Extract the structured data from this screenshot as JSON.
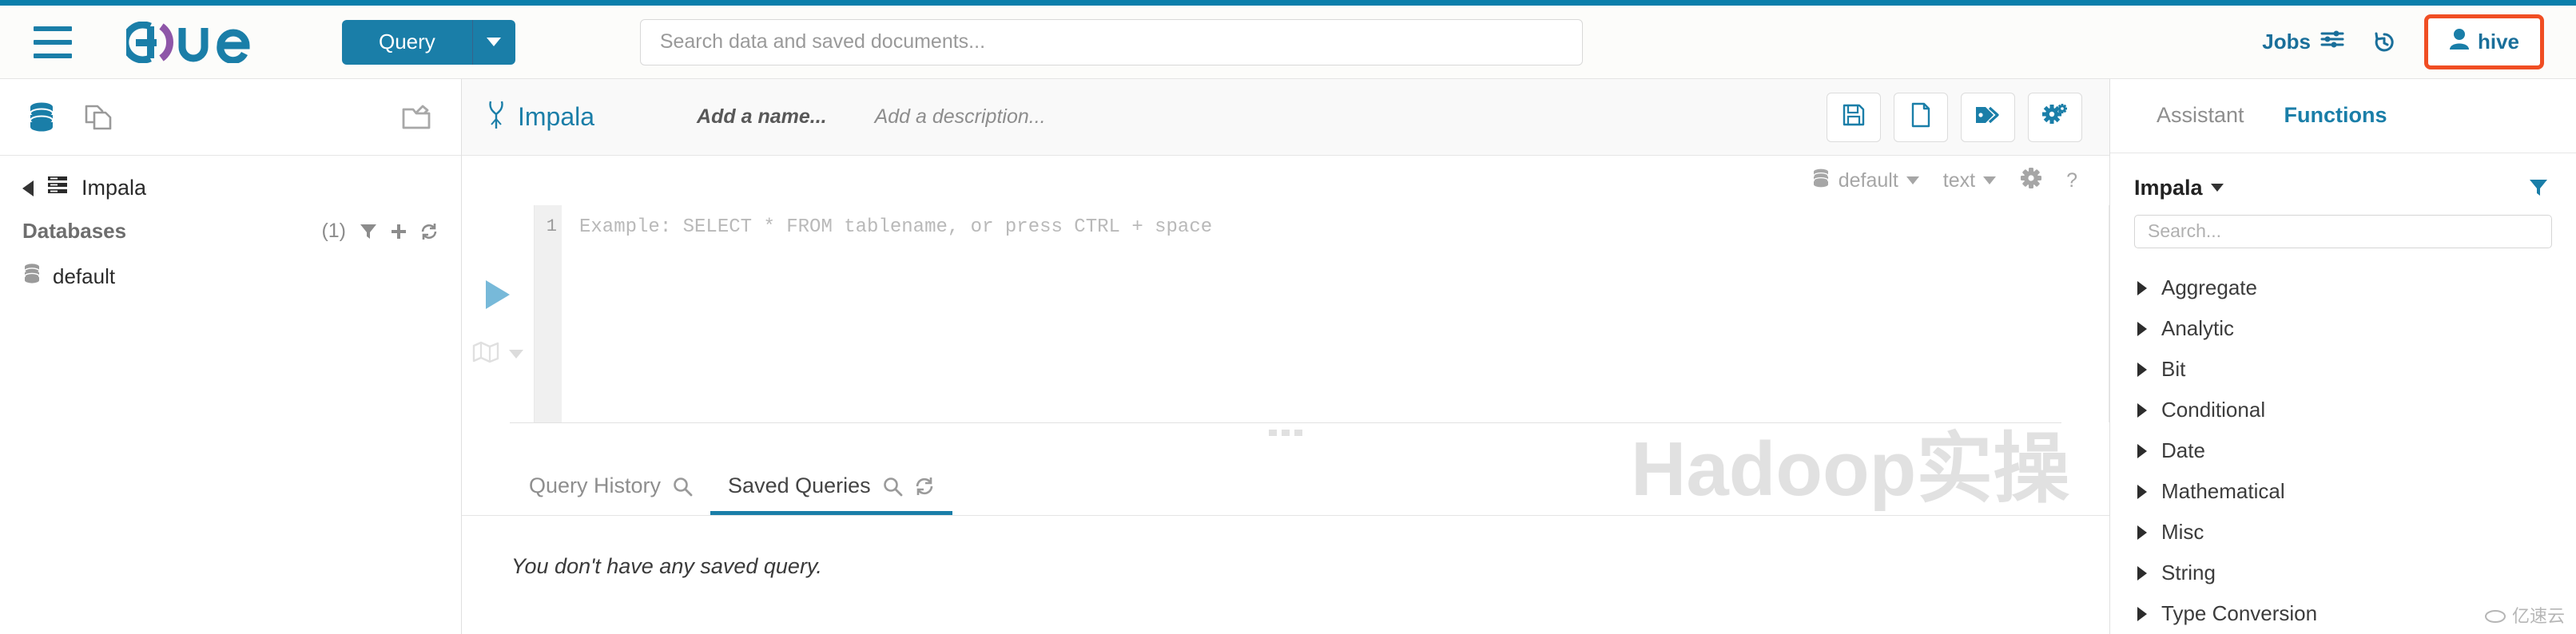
{
  "theme": {
    "accent": "#1A7EA8",
    "highlight": "#F04E23",
    "muted": "#8e8e8e"
  },
  "header": {
    "menu_icon": "hamburger-icon",
    "logo_text": "Hue",
    "query_button": "Query",
    "query_caret_icon": "chevron-down-icon",
    "search": {
      "value": "",
      "placeholder": "Search data and saved documents..."
    },
    "jobs_label": "Jobs",
    "jobs_icon": "sliders-icon",
    "history_icon": "history-clock-icon",
    "user": {
      "name": "hive",
      "icon": "user-icon"
    }
  },
  "sidebar": {
    "head_icons": [
      "database-icon",
      "documents-icon",
      "folder-open-icon"
    ],
    "breadcrumb": {
      "back_icon": "chevron-left-icon",
      "source_icon": "server-icon",
      "label": "Impala"
    },
    "databases": {
      "title": "Databases",
      "count": "(1)",
      "tools": [
        "filter-icon",
        "plus-icon",
        "refresh-icon"
      ],
      "items": [
        {
          "icon": "database-icon",
          "label": "default"
        }
      ]
    }
  },
  "editor": {
    "engine": {
      "icon": "impala-icon",
      "label": "Impala"
    },
    "name_placeholder": "Add a name...",
    "description_placeholder": "Add a description...",
    "actions": [
      {
        "name": "save-button",
        "icon": "floppy-save-icon"
      },
      {
        "name": "new-document-button",
        "icon": "file-icon"
      },
      {
        "name": "tags-button",
        "icon": "tags-icon"
      },
      {
        "name": "settings-button",
        "icon": "gears-icon"
      }
    ],
    "meta": {
      "database": "default",
      "database_icon": "database-icon",
      "format": "text",
      "settings_icon": "gear-icon",
      "help_icon": "question-mark-icon"
    },
    "gutter": {
      "run_icon": "play-icon",
      "explain_icon": "map-icon",
      "explain_caret_icon": "caret-down-icon"
    },
    "code": {
      "line_number": "1",
      "placeholder": "Example: SELECT * FROM tablename, or press CTRL + space"
    },
    "drag_handle": "resize-handle"
  },
  "results": {
    "tabs": [
      {
        "label": "Query History",
        "icons": [
          "search-icon"
        ],
        "active": false
      },
      {
        "label": "Saved Queries",
        "icons": [
          "search-icon",
          "refresh-icon"
        ],
        "active": true
      }
    ],
    "empty_message": "You don't have any saved query."
  },
  "right_panel": {
    "tabs": [
      {
        "label": "Assistant",
        "active": false
      },
      {
        "label": "Functions",
        "active": true
      }
    ],
    "engine": {
      "label": "Impala",
      "caret_icon": "caret-down-icon",
      "filter_icon": "filter-icon"
    },
    "search": {
      "value": "",
      "placeholder": "Search..."
    },
    "categories": [
      {
        "label": "Aggregate"
      },
      {
        "label": "Analytic"
      },
      {
        "label": "Bit"
      },
      {
        "label": "Conditional"
      },
      {
        "label": "Date"
      },
      {
        "label": "Mathematical"
      },
      {
        "label": "Misc"
      },
      {
        "label": "String"
      },
      {
        "label": "Type Conversion"
      }
    ]
  },
  "watermark": {
    "text": "Hadoop实操",
    "badge": "亿速云"
  }
}
